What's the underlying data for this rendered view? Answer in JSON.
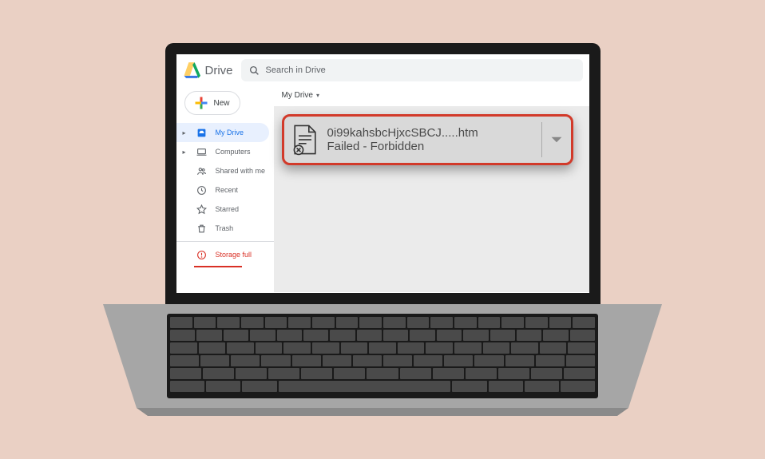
{
  "header": {
    "logo_text": "Drive",
    "search_placeholder": "Search in Drive"
  },
  "sidebar": {
    "new_label": "New",
    "items": [
      {
        "label": "My Drive",
        "icon": "drive-icon",
        "active": true,
        "expandable": true
      },
      {
        "label": "Computers",
        "icon": "computers-icon",
        "active": false,
        "expandable": true
      },
      {
        "label": "Shared with me",
        "icon": "people-icon",
        "active": false,
        "expandable": false
      },
      {
        "label": "Recent",
        "icon": "clock-icon",
        "active": false,
        "expandable": false
      },
      {
        "label": "Starred",
        "icon": "star-icon",
        "active": false,
        "expandable": false
      },
      {
        "label": "Trash",
        "icon": "trash-icon",
        "active": false,
        "expandable": false
      }
    ],
    "storage_label": "Storage full"
  },
  "main": {
    "breadcrumb": "My Drive"
  },
  "toast": {
    "filename": "0i99kahsbcHjxcSBCJ.....htm",
    "status": "Failed - Forbidden"
  }
}
